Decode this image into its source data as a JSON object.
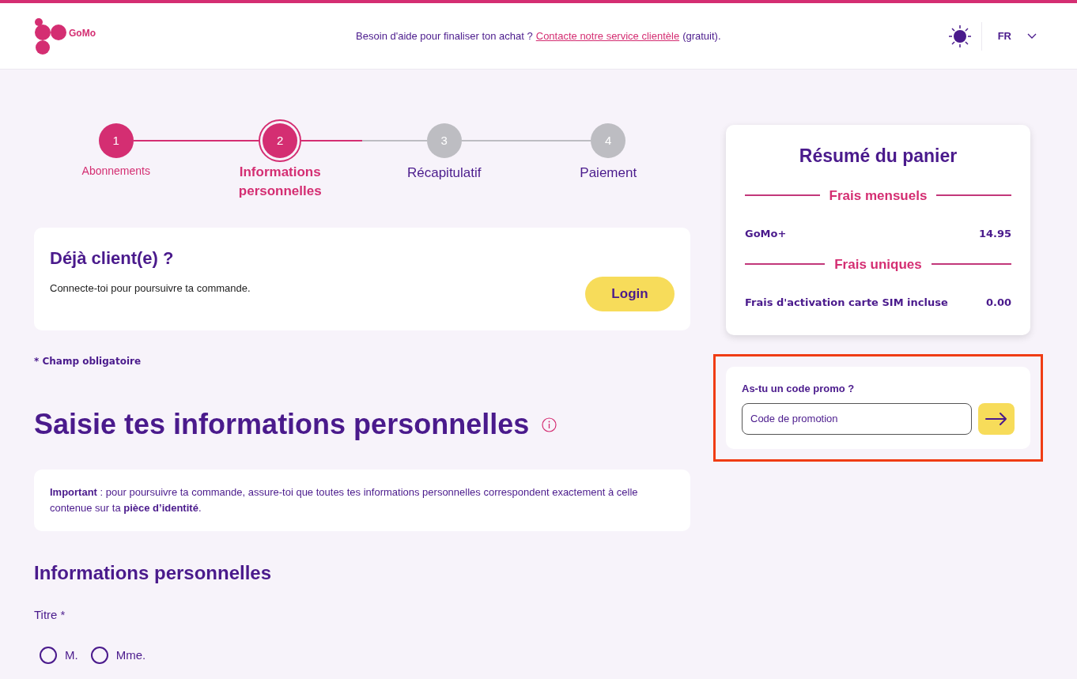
{
  "header": {
    "logo": "GoMo",
    "help_text": "Besoin d'aide pour finaliser ton achat ?",
    "help_link": "Contacte notre service clientèle",
    "help_suffix": "(gratuit).",
    "language": "FR"
  },
  "steps": [
    {
      "number": "1",
      "label": "Abonnements",
      "completed": true,
      "selected": false
    },
    {
      "number": "2",
      "label": "Informations personnelles",
      "completed": false,
      "selected": true
    },
    {
      "number": "3",
      "label": "Récapitulatif",
      "completed": false,
      "selected": false
    },
    {
      "number": "4",
      "label": "Paiement",
      "completed": false,
      "selected": false
    }
  ],
  "login_card": {
    "title": "Déjà client(e) ?",
    "text": "Connecte-toi pour poursuivre ta commande.",
    "button": "Login"
  },
  "required_note": "* Champ obligatoire",
  "page_title": "Saisie tes informations personnelles",
  "notice": "**Important** : pour poursuivre ta commande, assure-toi que toutes tes informations personnelles correspondent exactement à celle contenue sur ta **pièce d’identité**.",
  "section_title": "Informations personnelles",
  "title_field": {
    "label": "Titre *",
    "options": [
      {
        "label": "M.",
        "selected": false
      },
      {
        "label": "Mme.",
        "selected": false
      }
    ]
  },
  "cart": {
    "title": "Résumé du panier",
    "groups": [
      {
        "heading": "Frais mensuels",
        "rows": [
          {
            "name": "GoMo+",
            "price": "14.95"
          }
        ]
      },
      {
        "heading": "Frais uniques",
        "rows": [
          {
            "name": "Frais d'activation carte SIM incluse",
            "price": "0.00"
          }
        ]
      }
    ]
  },
  "promo": {
    "label": "As-tu un code promo ?",
    "placeholder": "Code de promotion",
    "highlighted": true
  }
}
